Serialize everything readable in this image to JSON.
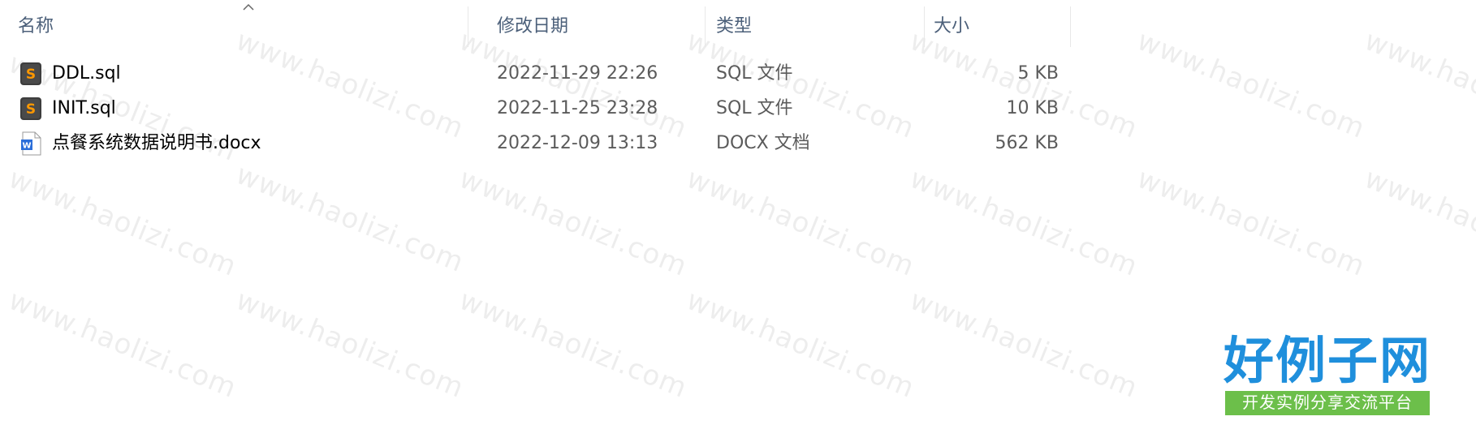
{
  "columns": {
    "name": "名称",
    "date": "修改日期",
    "type": "类型",
    "size": "大小"
  },
  "files": [
    {
      "name": "DDL.sql",
      "date": "2022-11-29 22:26",
      "type": "SQL 文件",
      "size": "5 KB",
      "icon": "sublime-sql-file-icon"
    },
    {
      "name": "INIT.sql",
      "date": "2022-11-25 23:28",
      "type": "SQL 文件",
      "size": "10 KB",
      "icon": "sublime-sql-file-icon"
    },
    {
      "name": "点餐系统数据说明书.docx",
      "date": "2022-12-09 13:13",
      "type": "DOCX 文档",
      "size": "562 KB",
      "icon": "word-document-icon"
    }
  ],
  "watermark": {
    "text": "www.haolizi.com"
  },
  "logo": {
    "title": "好例子网",
    "subtitle": "开发实例分享交流平台"
  },
  "colors": {
    "header_text": "#4c607a",
    "logo_blue": "#1f8fdc",
    "logo_green": "#6cbf4a"
  }
}
